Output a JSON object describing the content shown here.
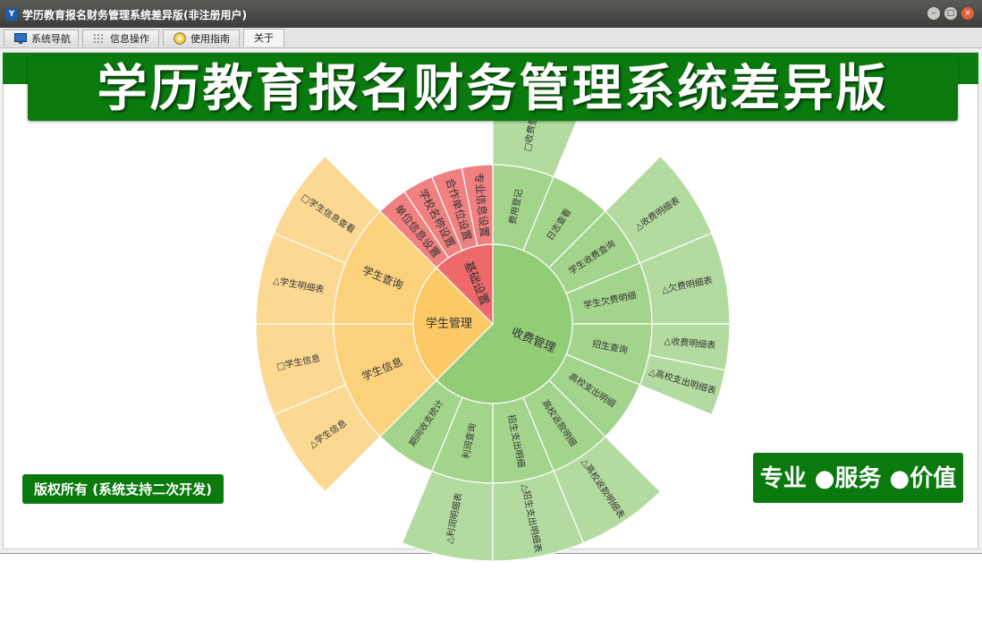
{
  "window": {
    "title": "学历教育报名财务管理系统差异版(非注册用户)",
    "app_icon": "yf-app-icon"
  },
  "tabs": [
    {
      "label": "系统导航",
      "icon": "monitor-icon",
      "active": false
    },
    {
      "label": "信息操作",
      "icon": "grid-icon",
      "active": false
    },
    {
      "label": "使用指南",
      "icon": "compass-icon",
      "active": false
    },
    {
      "label": "关于",
      "icon": "",
      "active": true
    }
  ],
  "banner": {
    "text": "学历教育报名财务管理系统差异版"
  },
  "copyright": {
    "text": "版权所有 (系统支持二次开发)"
  },
  "slogan": {
    "text": "专业 ●服务 ●价值"
  },
  "colors": {
    "green": "#0a7a0f",
    "fee": "#93cc77",
    "student": "#fbc965",
    "base": "#ee6a6a"
  },
  "sunburst": {
    "categories": [
      {
        "label": "收费管理",
        "color": "#93cc77",
        "children": [
          {
            "label": "费用登记",
            "leaves": [
              "□收费登记"
            ]
          },
          {
            "label": "日志查看",
            "leaves": []
          },
          {
            "label": "学生收费查询",
            "leaves": [
              "△收费明细表"
            ]
          },
          {
            "label": "学生欠费明细",
            "leaves": [
              "△欠费明细表"
            ]
          },
          {
            "label": "招生查询",
            "leaves": [
              "△收费明细表",
              "△高校支出明细表"
            ]
          },
          {
            "label": "高校支出明细",
            "leaves": []
          },
          {
            "label": "高校返款明细",
            "leaves": [
              "△高校返款明细表"
            ]
          },
          {
            "label": "招生支出明细",
            "leaves": [
              "△招生支出明细表"
            ]
          },
          {
            "label": "利润查询",
            "leaves": [
              "△利润明细表"
            ]
          },
          {
            "label": "期间收支统计",
            "leaves": []
          }
        ]
      },
      {
        "label": "学生管理",
        "color": "#fbc965",
        "children": [
          {
            "label": "学生信息",
            "leaves": [
              "△学生信息",
              "□学生信息"
            ]
          },
          {
            "label": "学生查询",
            "leaves": [
              "△学生明细表",
              "□学生信息查看"
            ]
          }
        ]
      },
      {
        "label": "基础设置",
        "color": "#ee6a6a",
        "children": [
          {
            "label": "单位信息设置",
            "leaves": []
          },
          {
            "label": "学校名称设置",
            "leaves": []
          },
          {
            "label": "合作单位设置",
            "leaves": []
          },
          {
            "label": "专业信息设置",
            "leaves": []
          }
        ]
      }
    ]
  }
}
